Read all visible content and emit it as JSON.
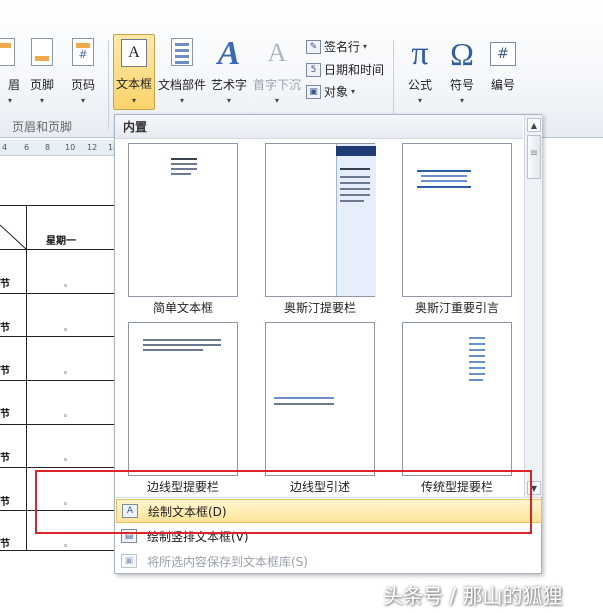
{
  "ribbon": {
    "buttons": [
      {
        "label": "眉",
        "icon": "header-icon"
      },
      {
        "label": "页脚",
        "icon": "footer-icon"
      },
      {
        "label": "页码",
        "icon": "page-number-icon"
      },
      {
        "label": "文本框",
        "icon": "textbox-icon"
      },
      {
        "label": "文档部件",
        "icon": "quick-parts-icon"
      },
      {
        "label": "艺术字",
        "icon": "wordart-icon"
      },
      {
        "label": "首字下沉",
        "icon": "drop-cap-icon"
      },
      {
        "label": "公式",
        "icon": "equation-icon"
      },
      {
        "label": "符号",
        "icon": "symbol-icon"
      },
      {
        "label": "编号",
        "icon": "number-icon"
      }
    ],
    "small_commands": [
      {
        "label": "签名行",
        "icon": "signature-line-icon"
      },
      {
        "label": "日期和时间",
        "icon": "date-time-icon"
      },
      {
        "label": "对象",
        "icon": "object-icon"
      }
    ],
    "group_header_footer": "页眉和页脚",
    "glyphs": {
      "wordart": "A",
      "dropcap": "A",
      "pi": "π",
      "omega": "Ω",
      "num": "#",
      "textbox": "A",
      "dropdown": "▾"
    }
  },
  "ruler": {
    "ticks": [
      "4",
      "6",
      "8",
      "10",
      "12",
      "14"
    ]
  },
  "document": {
    "column_header": "星期一",
    "row_labels": [
      "节",
      "节",
      "节",
      "节",
      "节",
      "节",
      "节"
    ],
    "cell_mark": "。"
  },
  "gallery": {
    "header": "内置",
    "items": [
      {
        "label": "简单文本框"
      },
      {
        "label": "奥斯汀提要栏"
      },
      {
        "label": "奥斯汀重要引言"
      },
      {
        "label": "边线型提要栏"
      },
      {
        "label": "边线型引述"
      },
      {
        "label": "传统型提要栏"
      }
    ],
    "menu": [
      {
        "label": "绘制文本框(D)",
        "enabled": true
      },
      {
        "label": "绘制竖排文本框(V)",
        "enabled": true
      },
      {
        "label": "将所选内容保存到文本框库(S)",
        "enabled": false
      }
    ]
  },
  "watermark": "头条号 / 那山的狐狸",
  "colors": {
    "highlight": "#fde49a",
    "annotation": "#e0252a",
    "accent": "#2f5ea8"
  }
}
